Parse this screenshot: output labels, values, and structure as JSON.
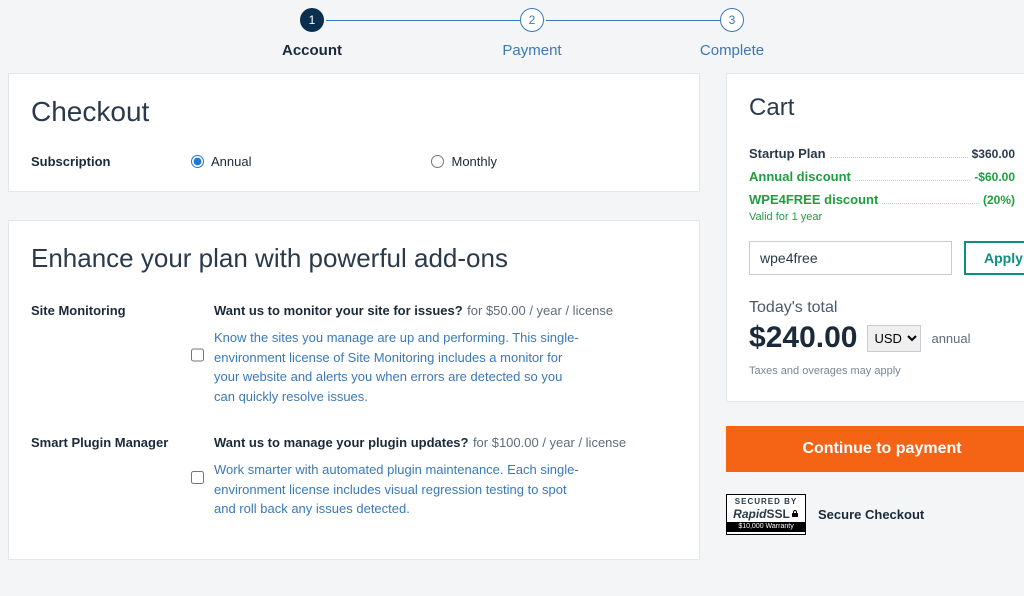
{
  "steps": {
    "s1": {
      "num": "1",
      "label": "Account"
    },
    "s2": {
      "num": "2",
      "label": "Payment"
    },
    "s3": {
      "num": "3",
      "label": "Complete"
    }
  },
  "checkout": {
    "title": "Checkout",
    "sub_label": "Subscription",
    "opt_annual": "Annual",
    "opt_monthly": "Monthly"
  },
  "enhance": {
    "title": "Enhance your plan with powerful add-ons",
    "addon1": {
      "name": "Site Monitoring",
      "question": "Want us to monitor your site for issues?",
      "price": " for $50.00 / year / license",
      "desc": "Know the sites you manage are up and performing. This single-environment license of Site Monitoring includes a monitor for your website and alerts you when errors are detected so you can quickly resolve issues."
    },
    "addon2": {
      "name": "Smart Plugin Manager",
      "question": "Want us to manage your plugin updates?",
      "price": " for $100.00 / year / license",
      "desc": "Work smarter with automated plugin maintenance. Each single-environment license includes visual regression testing to spot and roll back any issues detected."
    }
  },
  "cart": {
    "title": "Cart",
    "line1": {
      "label": "Startup Plan",
      "value": "$360.00"
    },
    "line2": {
      "label": "Annual discount",
      "value": "-$60.00"
    },
    "line3": {
      "label": "WPE4FREE discount",
      "value": "(20%)"
    },
    "valid_note": "Valid for 1 year",
    "coupon_value": "wpe4free",
    "apply_label": "Apply",
    "total_label": "Today's total",
    "total_amount": "$240.00",
    "currency": "USD",
    "billing_period": "annual",
    "tax_note": "Taxes and overages may apply",
    "continue_label": "Continue to payment",
    "secure_badge": {
      "top": "SECURED BY",
      "mid1": "Rapid",
      "mid2": "SSL",
      "bot": "$10,000 Warranty"
    },
    "secure_label": "Secure Checkout"
  }
}
